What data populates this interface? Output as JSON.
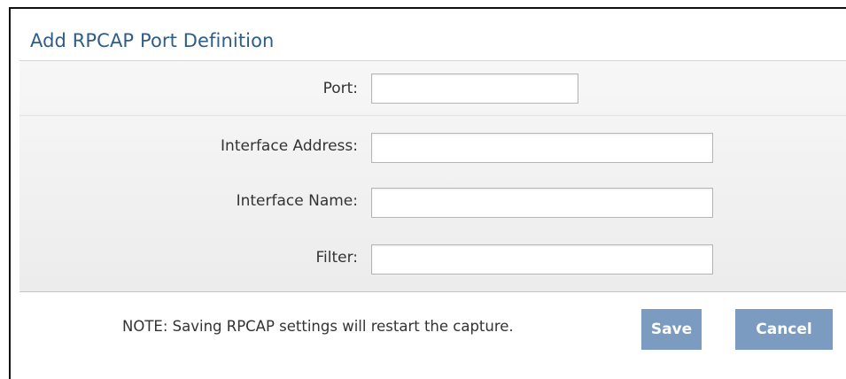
{
  "dialog": {
    "title": "Add RPCAP Port Definition"
  },
  "form": {
    "fields": [
      {
        "label": "Port:",
        "value": "",
        "placeholder": ""
      },
      {
        "label": "Interface Address:",
        "value": "",
        "placeholder": ""
      },
      {
        "label": "Interface Name:",
        "value": "",
        "placeholder": ""
      },
      {
        "label": "Filter:",
        "value": "",
        "placeholder": ""
      }
    ]
  },
  "footer": {
    "note": "NOTE: Saving RPCAP settings will restart the capture.",
    "save_label": "Save",
    "cancel_label": "Cancel"
  },
  "colors": {
    "title": "#2f5d8a",
    "button": "#7b9cc0",
    "panel": "#efefef"
  }
}
